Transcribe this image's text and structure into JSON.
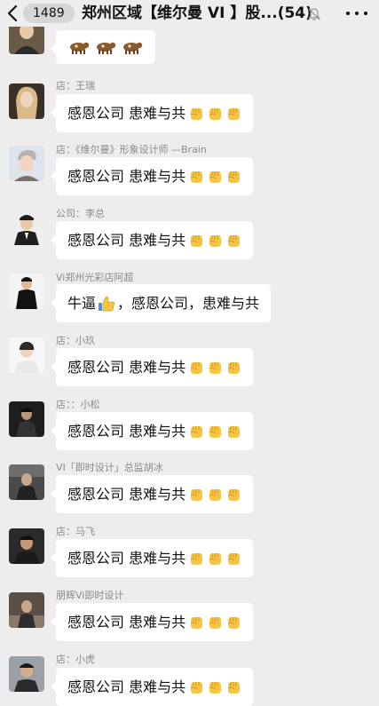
{
  "header": {
    "unread_count": "1489",
    "title": "郑州区域【维尔曼 VI 】股...",
    "member_count": "(54)"
  },
  "colors": {
    "background": "#ededed",
    "bubble": "#ffffff",
    "sender_text": "#8a8a8a",
    "emoji_fist": "#f6c544"
  },
  "messages": [
    {
      "sender": "",
      "text": "",
      "emoji": "cow",
      "emoji_count": 3
    },
    {
      "sender": "店：王瑞",
      "text": "感恩公司 患难与共",
      "emoji": "fist",
      "emoji_count": 3
    },
    {
      "sender": "店：《维尔曼》形象设计师 —Brain",
      "text": "感恩公司 患难与共",
      "emoji": "fist",
      "emoji_count": 3
    },
    {
      "sender": "公司：李总",
      "text": "感恩公司 患难与共",
      "emoji": "fist",
      "emoji_count": 3
    },
    {
      "sender": "Vi郑州光彩店阿超",
      "text_before": "牛逼",
      "text_after": "，感恩公司，患难与共",
      "emoji": "thumbs-up",
      "emoji_count": 1
    },
    {
      "sender": "店：小玖",
      "text": "感恩公司 患难与共",
      "emoji": "fist",
      "emoji_count": 3
    },
    {
      "sender": "店：：小松",
      "text": "感恩公司 患难与共",
      "emoji": "fist",
      "emoji_count": 3
    },
    {
      "sender": "VI「即时设计」总监胡冰",
      "text": "感恩公司 患难与共",
      "emoji": "fist",
      "emoji_count": 3
    },
    {
      "sender": "店：马飞",
      "text": "感恩公司 患难与共",
      "emoji": "fist",
      "emoji_count": 3
    },
    {
      "sender": "朋辉Vi即时设计",
      "text": "感恩公司 患难与共",
      "emoji": "fist",
      "emoji_count": 3
    },
    {
      "sender": "店：小虎",
      "text": "感恩公司 患难与共",
      "emoji": "fist",
      "emoji_count": 3
    }
  ]
}
